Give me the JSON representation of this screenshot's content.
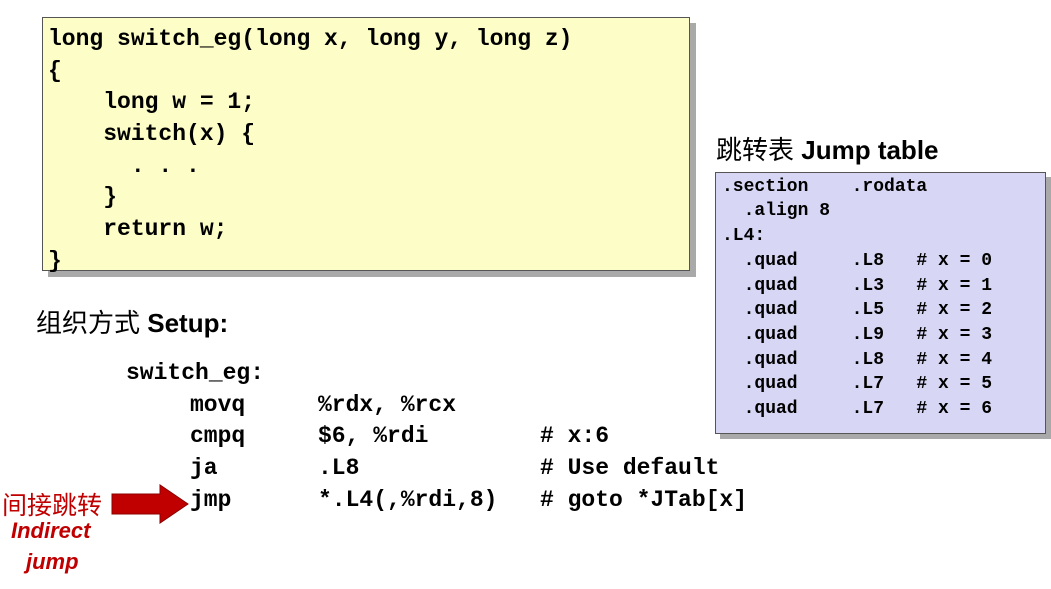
{
  "code_box": {
    "lines": [
      "long switch_eg(long x, long y, long z)",
      "{",
      "    long w = 1;",
      "    switch(x) {",
      "      . . .",
      "    }",
      "    return w;",
      "}"
    ]
  },
  "jump_table": {
    "title_cn": "跳转表",
    "title_en": "Jump table",
    "lines": [
      ".section    .rodata",
      "  .align 8",
      ".L4:",
      "  .quad     .L8   # x = 0",
      "  .quad     .L3   # x = 1",
      "  .quad     .L5   # x = 2",
      "  .quad     .L9   # x = 3",
      "  .quad     .L8   # x = 4",
      "  .quad     .L7   # x = 5",
      "  .quad     .L7   # x = 6"
    ]
  },
  "setup": {
    "title_cn": "组织方式",
    "title_en": "Setup:",
    "label": "switch_eg:",
    "rows": [
      {
        "op": "movq",
        "args": "%rdx, %rcx",
        "comment": ""
      },
      {
        "op": "cmpq",
        "args": "$6, %rdi",
        "comment": "# x:6"
      },
      {
        "op": "ja",
        "args": ".L8",
        "comment": "# Use default"
      },
      {
        "op": "jmp",
        "args": "*.L4(,%rdi,8)",
        "comment": "# goto *JTab[x]"
      }
    ]
  },
  "annotation": {
    "cn": "间接跳转",
    "en_line1": "Indirect",
    "en_line2": "jump",
    "color": "#c00000"
  }
}
